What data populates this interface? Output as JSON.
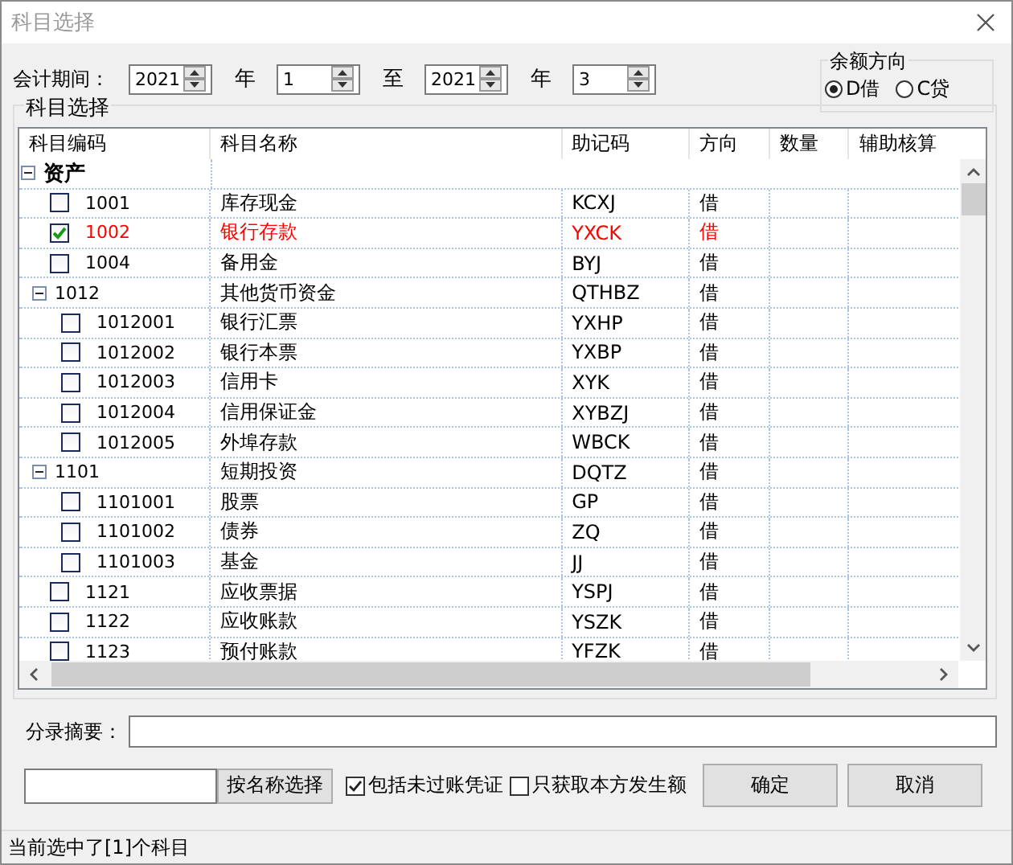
{
  "window": {
    "title": "科目选择"
  },
  "period": {
    "label": "会计期间：",
    "fields": [
      {
        "value": "2021",
        "unit": "年"
      },
      {
        "value": "1",
        "unit": "至"
      },
      {
        "value": "2021",
        "unit": "年"
      },
      {
        "value": "3"
      }
    ]
  },
  "balance_direction": {
    "title": "余额方向",
    "options": [
      {
        "label": "D借",
        "selected": true
      },
      {
        "label": "C贷",
        "selected": false
      }
    ]
  },
  "account_group": {
    "title": "科目选择",
    "columns": [
      "科目编码",
      "科目名称",
      "助记码",
      "方向",
      "数量",
      "辅助核算"
    ],
    "tree": [
      {
        "label": "资产",
        "expanded": true,
        "children": [
          {
            "code": "1001",
            "name": "库存现金",
            "mnemonic": "KCXJ",
            "direction": "借",
            "checked": false
          },
          {
            "code": "1002",
            "name": "银行存款",
            "mnemonic": "YXCK",
            "direction": "借",
            "checked": true
          },
          {
            "code": "1004",
            "name": "备用金",
            "mnemonic": "BYJ",
            "direction": "借",
            "checked": false
          },
          {
            "code": "1012",
            "name": "其他货币资金",
            "mnemonic": "QTHBZ",
            "direction": "借",
            "expanded": true,
            "children": [
              {
                "code": "1012001",
                "name": "银行汇票",
                "mnemonic": "YXHP",
                "direction": "借",
                "checked": false
              },
              {
                "code": "1012002",
                "name": "银行本票",
                "mnemonic": "YXBP",
                "direction": "借",
                "checked": false
              },
              {
                "code": "1012003",
                "name": "信用卡",
                "mnemonic": "XYK",
                "direction": "借",
                "checked": false
              },
              {
                "code": "1012004",
                "name": "信用保证金",
                "mnemonic": "XYBZJ",
                "direction": "借",
                "checked": false
              },
              {
                "code": "1012005",
                "name": "外埠存款",
                "mnemonic": "WBCK",
                "direction": "借",
                "checked": false
              }
            ]
          },
          {
            "code": "1101",
            "name": "短期投资",
            "mnemonic": "DQTZ",
            "direction": "借",
            "expanded": true,
            "children": [
              {
                "code": "1101001",
                "name": "股票",
                "mnemonic": "GP",
                "direction": "借",
                "checked": false
              },
              {
                "code": "1101002",
                "name": "债券",
                "mnemonic": "ZQ",
                "direction": "借",
                "checked": false
              },
              {
                "code": "1101003",
                "name": "基金",
                "mnemonic": "JJ",
                "direction": "借",
                "checked": false
              }
            ]
          },
          {
            "code": "1121",
            "name": "应收票据",
            "mnemonic": "YSPJ",
            "direction": "借",
            "checked": false
          },
          {
            "code": "1122",
            "name": "应收账款",
            "mnemonic": "YSZK",
            "direction": "借",
            "checked": false
          },
          {
            "code": "1123",
            "name": "预付账款",
            "mnemonic": "YFZK",
            "direction": "借",
            "checked": false
          }
        ]
      }
    ]
  },
  "summary": {
    "label": "分录摘要："
  },
  "name_search": {
    "button": "按名称选择"
  },
  "options": [
    {
      "label": "包括未过账凭证",
      "checked": true
    },
    {
      "label": "只获取本方发生额",
      "checked": false
    }
  ],
  "buttons": [
    "确定",
    "取消"
  ],
  "status_bar": "当前选中了[1]个科目"
}
